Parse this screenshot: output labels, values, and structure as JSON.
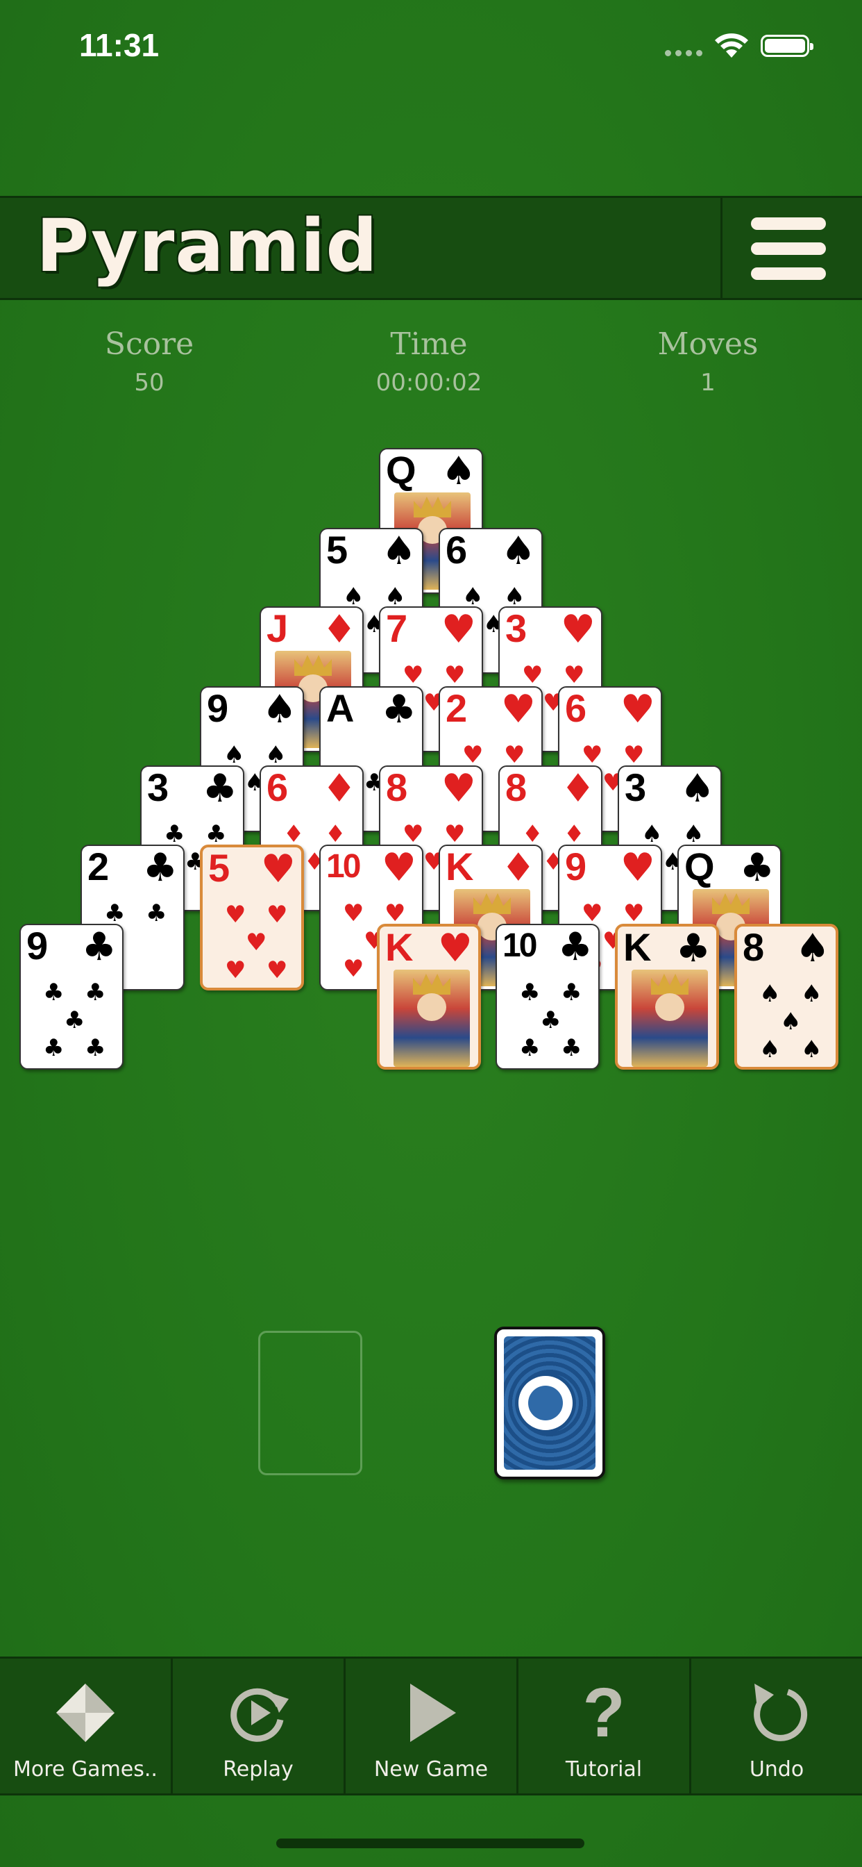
{
  "status_bar": {
    "time": "11:31"
  },
  "header": {
    "title": "Pyramid"
  },
  "stats": {
    "score_label": "Score",
    "score_value": "50",
    "time_label": "Time",
    "time_value": "00:00:02",
    "moves_label": "Moves",
    "moves_value": "1"
  },
  "colors": {
    "felt": "#23751a",
    "bar": "#174d11",
    "highlight": "#d98a3a",
    "red_suit": "#e02020"
  },
  "pyramid": {
    "rows": [
      [
        {
          "rank": "Q",
          "suit": "♠",
          "color": "black"
        }
      ],
      [
        {
          "rank": "5",
          "suit": "♠",
          "color": "black"
        },
        {
          "rank": "6",
          "suit": "♠",
          "color": "black"
        }
      ],
      [
        {
          "rank": "J",
          "suit": "♦",
          "color": "red"
        },
        {
          "rank": "7",
          "suit": "♥",
          "color": "red"
        },
        {
          "rank": "3",
          "suit": "♥",
          "color": "red"
        }
      ],
      [
        {
          "rank": "9",
          "suit": "♠",
          "color": "black"
        },
        {
          "rank": "A",
          "suit": "♣",
          "color": "black"
        },
        {
          "rank": "2",
          "suit": "♥",
          "color": "red"
        },
        {
          "rank": "6",
          "suit": "♥",
          "color": "red"
        }
      ],
      [
        {
          "rank": "3",
          "suit": "♣",
          "color": "black"
        },
        {
          "rank": "6",
          "suit": "♦",
          "color": "red"
        },
        {
          "rank": "8",
          "suit": "♥",
          "color": "red"
        },
        {
          "rank": "8",
          "suit": "♦",
          "color": "red"
        },
        {
          "rank": "3",
          "suit": "♠",
          "color": "black"
        }
      ],
      [
        {
          "rank": "2",
          "suit": "♣",
          "color": "black"
        },
        {
          "rank": "5",
          "suit": "♥",
          "color": "red",
          "selected": true
        },
        {
          "rank": "10",
          "suit": "♥",
          "color": "red"
        },
        {
          "rank": "K",
          "suit": "♦",
          "color": "red"
        },
        {
          "rank": "9",
          "suit": "♥",
          "color": "red"
        },
        {
          "rank": "Q",
          "suit": "♣",
          "color": "black"
        }
      ],
      [
        {
          "rank": "9",
          "suit": "♣",
          "color": "black"
        },
        {
          "rank": "K",
          "suit": "♥",
          "color": "red",
          "selected": true
        },
        {
          "rank": "10",
          "suit": "♣",
          "color": "black"
        },
        {
          "rank": "K",
          "suit": "♣",
          "color": "black",
          "selected": true
        },
        {
          "rank": "8",
          "suit": "♠",
          "color": "black",
          "selected": true
        }
      ]
    ]
  },
  "toolbar": {
    "more_games": "More Games..",
    "replay": "Replay",
    "new_game": "New Game",
    "tutorial": "Tutorial",
    "undo": "Undo",
    "tutorial_glyph": "?"
  },
  "icons": [
    "menu-icon",
    "more-games-icon",
    "replay-icon",
    "play-icon",
    "question-icon",
    "undo-icon",
    "wifi-icon",
    "battery-icon"
  ]
}
